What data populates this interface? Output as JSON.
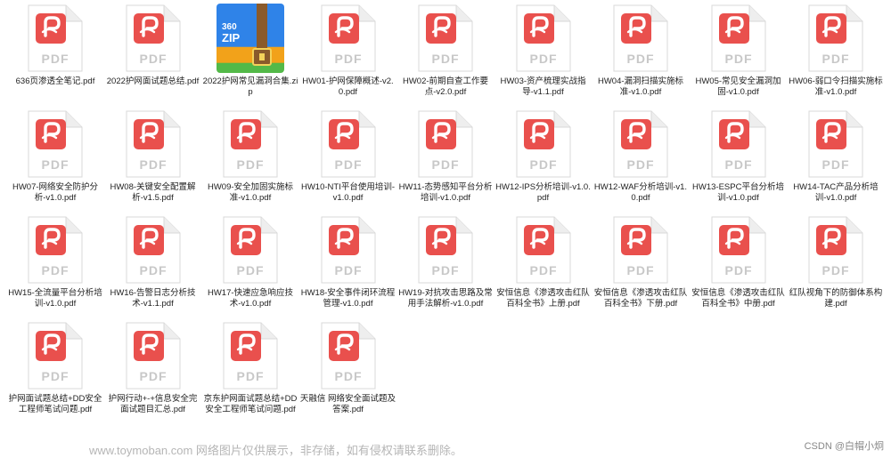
{
  "files": [
    {
      "name": "636页渗透全笔记.pdf",
      "type": "pdf"
    },
    {
      "name": "2022护网面试题总结.pdf",
      "type": "pdf"
    },
    {
      "name": "2022护网常见漏洞合集.zip",
      "type": "zip"
    },
    {
      "name": "HW01-护网保障概述-v2.0.pdf",
      "type": "pdf"
    },
    {
      "name": "HW02-前期自查工作要点-v2.0.pdf",
      "type": "pdf"
    },
    {
      "name": "HW03-资产梳理实战指导-v1.1.pdf",
      "type": "pdf"
    },
    {
      "name": "HW04-漏洞扫描实施标准-v1.0.pdf",
      "type": "pdf"
    },
    {
      "name": "HW05-常见安全漏洞加固-v1.0.pdf",
      "type": "pdf"
    },
    {
      "name": "HW06-弱口令扫描实施标准-v1.0.pdf",
      "type": "pdf"
    },
    {
      "name": "HW07-网络安全防护分析-v1.0.pdf",
      "type": "pdf"
    },
    {
      "name": "HW08-关键安全配置解析-v1.5.pdf",
      "type": "pdf"
    },
    {
      "name": "HW09-安全加固实施标准-v1.0.pdf",
      "type": "pdf"
    },
    {
      "name": "HW10-NTI平台使用培训-v1.0.pdf",
      "type": "pdf"
    },
    {
      "name": "HW11-态势感知平台分析培训-v1.0.pdf",
      "type": "pdf"
    },
    {
      "name": "HW12-IPS分析培训-v1.0.pdf",
      "type": "pdf"
    },
    {
      "name": "HW12-WAF分析培训-v1.0.pdf",
      "type": "pdf"
    },
    {
      "name": "HW13-ESPC平台分析培训-v1.0.pdf",
      "type": "pdf"
    },
    {
      "name": "HW14-TAC产品分析培训-v1.0.pdf",
      "type": "pdf"
    },
    {
      "name": "HW15-全流量平台分析培训-v1.0.pdf",
      "type": "pdf"
    },
    {
      "name": "HW16-告警日志分析技术-v1.1.pdf",
      "type": "pdf"
    },
    {
      "name": "HW17-快速应急响应技术-v1.0.pdf",
      "type": "pdf"
    },
    {
      "name": "HW18-安全事件闭环流程管理-v1.0.pdf",
      "type": "pdf"
    },
    {
      "name": "HW19-对抗攻击思路及常用手法解析-v1.0.pdf",
      "type": "pdf"
    },
    {
      "name": "安恒信息《渗透攻击红队百科全书》上册.pdf",
      "type": "pdf"
    },
    {
      "name": "安恒信息《渗透攻击红队百科全书》下册.pdf",
      "type": "pdf"
    },
    {
      "name": "安恒信息《渗透攻击红队百科全书》中册.pdf",
      "type": "pdf"
    },
    {
      "name": "红队视角下的防御体系构建.pdf",
      "type": "pdf"
    },
    {
      "name": "护网面试题总结+DD安全工程师笔试问题.pdf",
      "type": "pdf"
    },
    {
      "name": "护网行动+-+信息安全完面试题目汇总.pdf",
      "type": "pdf"
    },
    {
      "name": "京东护网面试题总结+DD安全工程师笔试问题.pdf",
      "type": "pdf"
    },
    {
      "name": "天融信 网络安全面试题及答案.pdf",
      "type": "pdf"
    }
  ],
  "icons": {
    "pdf_label": "PDF",
    "zip_brand": "360",
    "zip_label": "ZIP",
    "pdf_color": "#e9504d",
    "zip_gradient": [
      "#2f83e8",
      "#f2a21a",
      "#53b948"
    ]
  },
  "watermark": "www.toymoban.com 网络图片仅供展示，非存储，如有侵权请联系删除。",
  "attribution": "CSDN @白帽小炯"
}
